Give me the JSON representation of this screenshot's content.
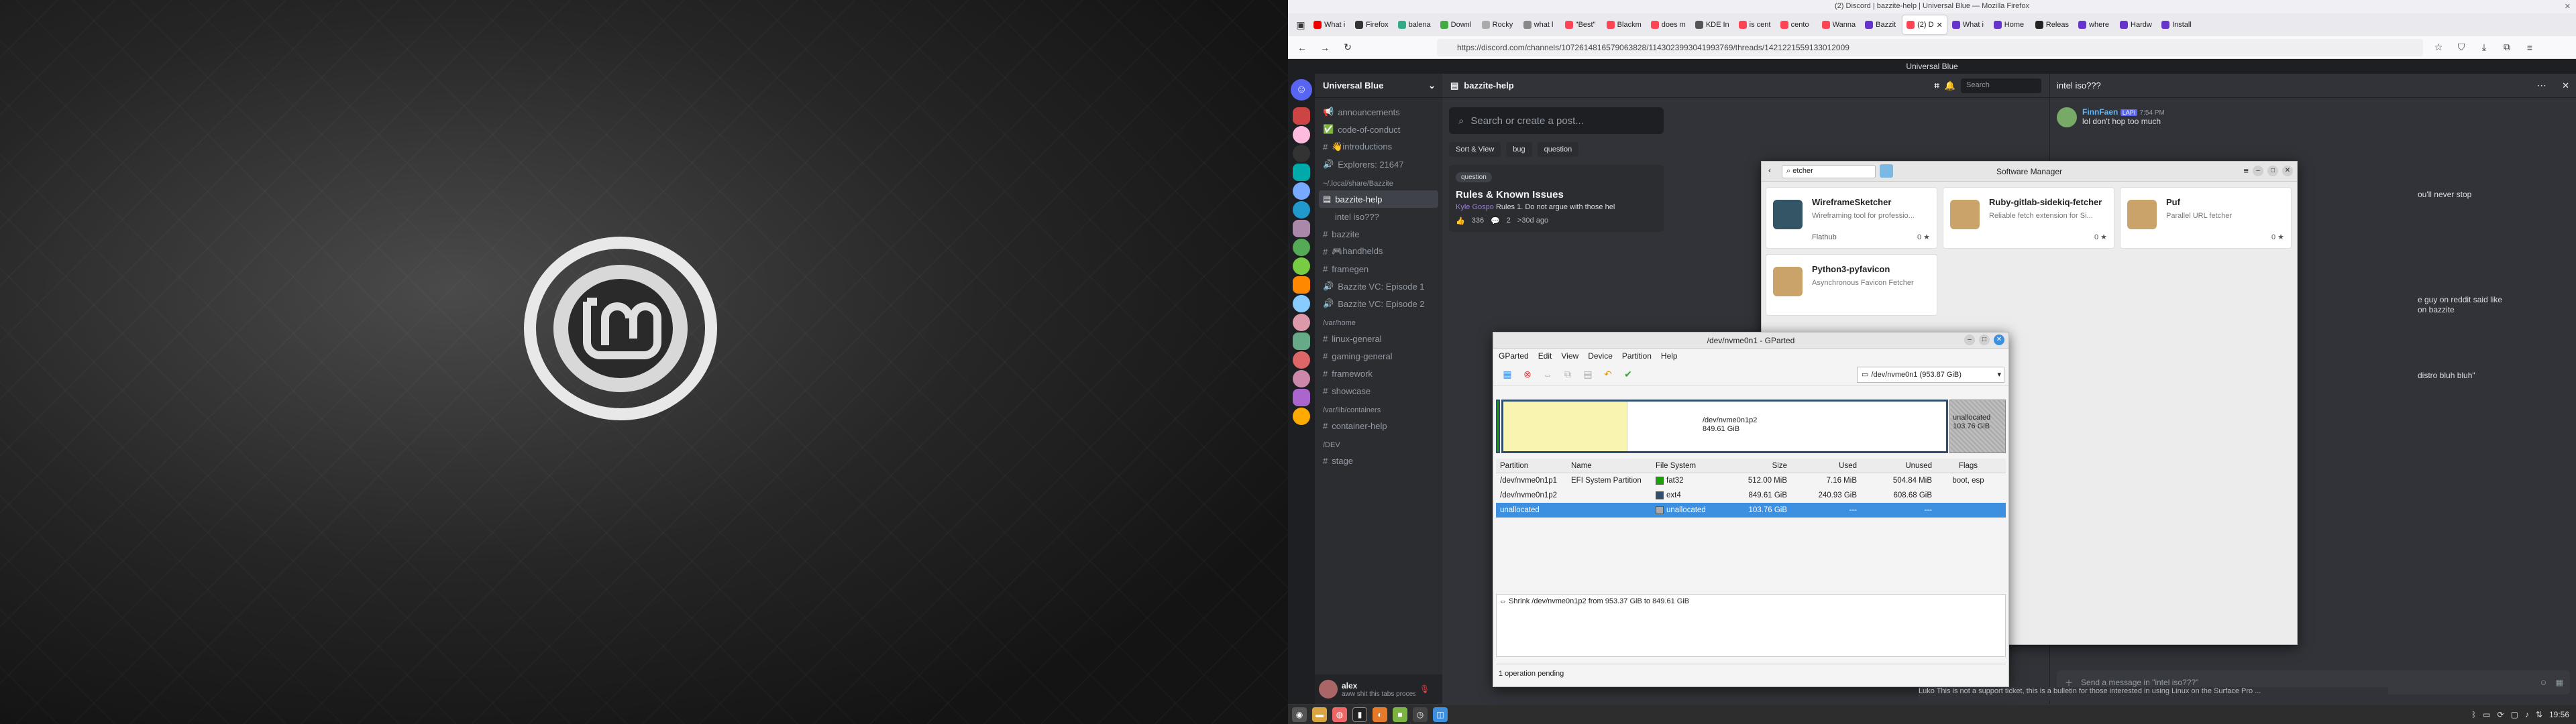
{
  "window_title": "(2) Discord | bazzite-help | Universal Blue — Mozilla Firefox",
  "tabs": [
    {
      "label": "What i",
      "color": "#e00"
    },
    {
      "label": "Firefox",
      "color": "#333"
    },
    {
      "label": "balena",
      "color": "#3a8"
    },
    {
      "label": "Downl",
      "color": "#4a4"
    },
    {
      "label": "Rocky",
      "color": "#aaa"
    },
    {
      "label": "what l",
      "color": "#888"
    },
    {
      "label": "\"Best\"",
      "color": "#f45"
    },
    {
      "label": "Blackm",
      "color": "#f45"
    },
    {
      "label": "does m",
      "color": "#f45"
    },
    {
      "label": "KDE In",
      "color": "#555"
    },
    {
      "label": "is cent",
      "color": "#f45"
    },
    {
      "label": "cento",
      "color": "#f45"
    },
    {
      "label": "Wanna",
      "color": "#f45"
    },
    {
      "label": "Bazzit",
      "color": "#63c"
    },
    {
      "label": "(2) D",
      "color": "#f45",
      "active": true
    },
    {
      "label": "What i",
      "color": "#63c"
    },
    {
      "label": "Home",
      "color": "#63c"
    },
    {
      "label": "Releas",
      "color": "#222"
    },
    {
      "label": "where",
      "color": "#63c"
    },
    {
      "label": "Hardw",
      "color": "#63c"
    },
    {
      "label": "Install",
      "color": "#63c"
    }
  ],
  "url": "https://discord.com/channels/1072614816579063828/1143023993041993769/threads/1421221559133012009",
  "discord": {
    "top_title": "Universal Blue",
    "server_name": "Universal Blue",
    "forum_title": "bazzite-help",
    "forum_search_placeholder": "Search or create a post...",
    "search_placeholder": "Search",
    "sort_label": "Sort & View",
    "filter_tags": [
      "bug",
      "question"
    ],
    "post": {
      "tag": "question",
      "title": "Rules & Known Issues",
      "author": "Kyle Gospo",
      "excerpt": "Rules  1. Do not argue with those hel",
      "reactions": "336",
      "replies": "2",
      "age": ">30d ago"
    },
    "thread_title": "intel iso???",
    "messages": [
      {
        "author": "FinnFaen",
        "badge": "LAPI",
        "time": "7:54 PM",
        "text": "lol don't hop too much"
      },
      {
        "text": "ou'll never stop"
      },
      {
        "text": "e guy on reddit said like"
      },
      {
        "text": "on bazzite"
      },
      {
        "text": "distro bluh bluh\""
      }
    ],
    "message_placeholder": "Send a message in \"intel iso???\"",
    "user": {
      "name": "alex",
      "status": "aww shit this tabs processi..."
    },
    "channels_top": [
      {
        "icon": "📢",
        "label": "announcements"
      },
      {
        "icon": "✅",
        "label": "code-of-conduct"
      },
      {
        "icon": "#",
        "label": "👋introductions"
      },
      {
        "icon": "🔊",
        "label": "Explorers: 21647"
      }
    ],
    "category_1": "~/.local/share/Bazzite",
    "selected_channel": "bazzite-help",
    "thread_channel": "intel iso???",
    "channels_mid": [
      {
        "icon": "#",
        "label": "bazzite"
      },
      {
        "icon": "#",
        "label": "🎮handhelds"
      },
      {
        "icon": "#",
        "label": "framegen"
      },
      {
        "icon": "🔊",
        "label": "Bazzite VC: Episode 1"
      },
      {
        "icon": "🔊",
        "label": "Bazzite VC: Episode 2"
      }
    ],
    "category_2": "/var/home",
    "channels_home": [
      {
        "icon": "#",
        "label": "linux-general"
      },
      {
        "icon": "#",
        "label": "gaming-general"
      },
      {
        "icon": "#",
        "label": "framework"
      },
      {
        "icon": "#",
        "label": "showcase"
      }
    ],
    "category_3": "/var/lib/containers",
    "channels_cont": [
      {
        "icon": "#",
        "label": "container-help"
      }
    ],
    "category_4": "/DEV",
    "channels_dev": [
      {
        "icon": "#",
        "label": "stage"
      }
    ]
  },
  "software_manager": {
    "title": "Software Manager",
    "search": "etcher",
    "apps": [
      {
        "name": "WireframeSketcher",
        "desc": "Wireframing tool for professio...",
        "source": "Flathub",
        "stars": "0 ★",
        "color": "#356"
      },
      {
        "name": "Ruby-gitlab-sidekiq-fetcher",
        "desc": "Reliable fetch extension for Si...",
        "stars": "0 ★",
        "color": "#c9a36a"
      },
      {
        "name": "Puf",
        "desc": "Parallel URL fetcher",
        "stars": "0 ★",
        "color": "#c9a36a"
      },
      {
        "name": "Python3-pyfavicon",
        "desc": "Asynchronous Favicon Fetcher",
        "stars": "",
        "color": "#c9a36a"
      }
    ]
  },
  "gparted": {
    "title": "/dev/nvme0n1 - GParted",
    "menu": [
      "GParted",
      "Edit",
      "View",
      "Device",
      "Partition",
      "Help"
    ],
    "device": "/dev/nvme0n1 (953.87 GiB)",
    "bar": {
      "p2_label": "/dev/nvme0n1p2",
      "p2_size": "849.61 GiB",
      "un_label": "unallocated",
      "un_size": "103.76 GiB",
      "used_fraction": 0.28
    },
    "headers": [
      "Partition",
      "Name",
      "File System",
      "Size",
      "Used",
      "Unused",
      "Flags"
    ],
    "rows": [
      {
        "partition": "/dev/nvme0n1p1",
        "name": "EFI System Partition",
        "fs": "fat32",
        "fs_color": "#18a303",
        "size": "512.00 MiB",
        "used": "7.16 MiB",
        "unused": "504.84 MiB",
        "flags": "boot, esp"
      },
      {
        "partition": "/dev/nvme0n1p2",
        "name": "",
        "fs": "ext4",
        "fs_color": "#314e6c",
        "size": "849.61 GiB",
        "used": "240.93 GiB",
        "unused": "608.68 GiB",
        "flags": ""
      },
      {
        "partition": "unallocated",
        "name": "",
        "fs": "unallocated",
        "fs_color": "#a9a9a9",
        "size": "103.76 GiB",
        "used": "---",
        "unused": "---",
        "flags": "",
        "selected": true
      }
    ],
    "pending_op": "Shrink /dev/nvme0n1p2 from 953.37 GiB to 849.61 GiB",
    "status": "1 operation pending"
  },
  "bottom_snippet": "Luko This is not a support ticket, this is a bulletin for those interested in using Linux on the Surface Pro ...",
  "clock": "19:56"
}
